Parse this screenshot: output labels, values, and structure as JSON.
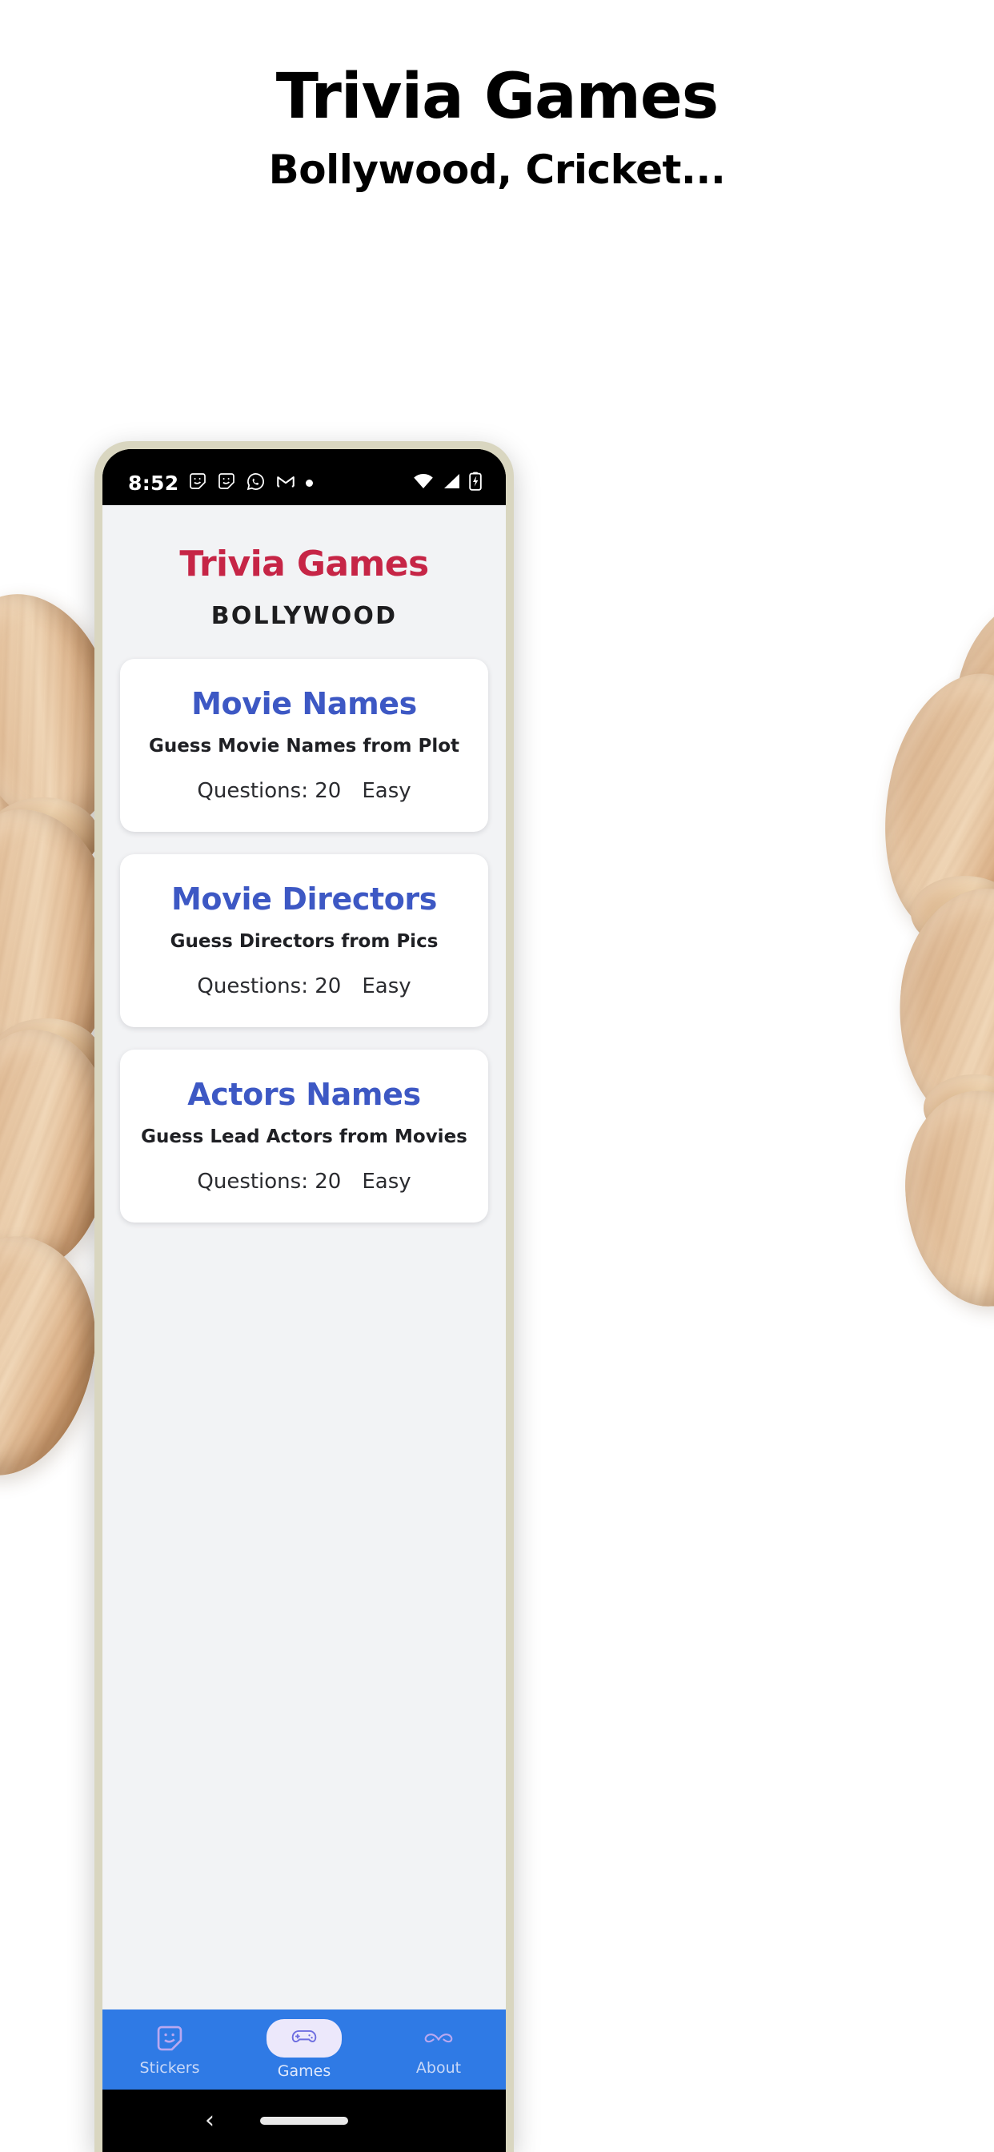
{
  "promo": {
    "title": "Trivia Games",
    "subtitle": "Bollywood, Cricket..."
  },
  "colors": {
    "brand_red": "#c62546",
    "card_title_blue": "#3d58c4",
    "nav_blue": "#2f7ae5",
    "nav_pill": "#ece8fb",
    "app_bg": "#f2f3f5",
    "card_bg": "#ffffff"
  },
  "phone": {
    "statusbar": {
      "time": "8:52",
      "left_icons": [
        "sticker-icon",
        "sticker-icon",
        "whatsapp-icon",
        "gmail-icon",
        "dot-icon"
      ],
      "right_icons": [
        "wifi-icon",
        "cellular-signal-icon",
        "battery-charging-icon"
      ]
    },
    "app": {
      "title": "Trivia Games",
      "subtitle": "BOLLYWOOD",
      "cards": [
        {
          "title": "Movie Names",
          "description": "Guess Movie Names from Plot",
          "questions_label": "Questions: 20",
          "difficulty": "Easy"
        },
        {
          "title": "Movie Directors",
          "description": "Guess Directors from Pics",
          "questions_label": "Questions: 20",
          "difficulty": "Easy"
        },
        {
          "title": "Actors Names",
          "description": "Guess Lead Actors from Movies",
          "questions_label": "Questions: 20",
          "difficulty": "Easy"
        }
      ],
      "bottom_nav": [
        {
          "label": "Stickers",
          "icon": "sticker-icon",
          "active": false
        },
        {
          "label": "Games",
          "icon": "gamepad-icon",
          "active": true
        },
        {
          "label": "About",
          "icon": "mustache-icon",
          "active": false
        }
      ]
    },
    "gesture_nav": {
      "back": "back-chevron-icon",
      "home": "home-pill-icon"
    }
  }
}
